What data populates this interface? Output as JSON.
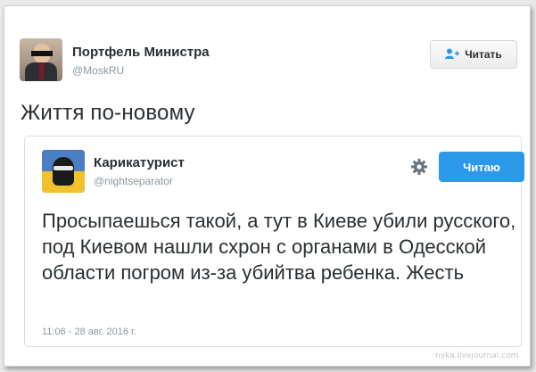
{
  "tweet": {
    "author_name": "Портфель Министра",
    "author_handle": "@MoskRU",
    "follow_label": "Читать",
    "text": "Життя по-новому"
  },
  "quoted": {
    "author_name": "Карикатурист",
    "author_handle": "@nightseparator",
    "reading_label": "Читаю",
    "text": "Просыпаешься такой, а тут в Киеве убили русского, под Киевом нашли схрон с органами в Одесской области погром из-за убийтва ребенка. Жесть",
    "timestamp": "11:06 - 28 авг. 2016 г."
  },
  "colors": {
    "primary": "#2b98e8",
    "muted": "#8899a6",
    "text": "#292f33"
  },
  "watermark": "nyka.livejournal.com"
}
